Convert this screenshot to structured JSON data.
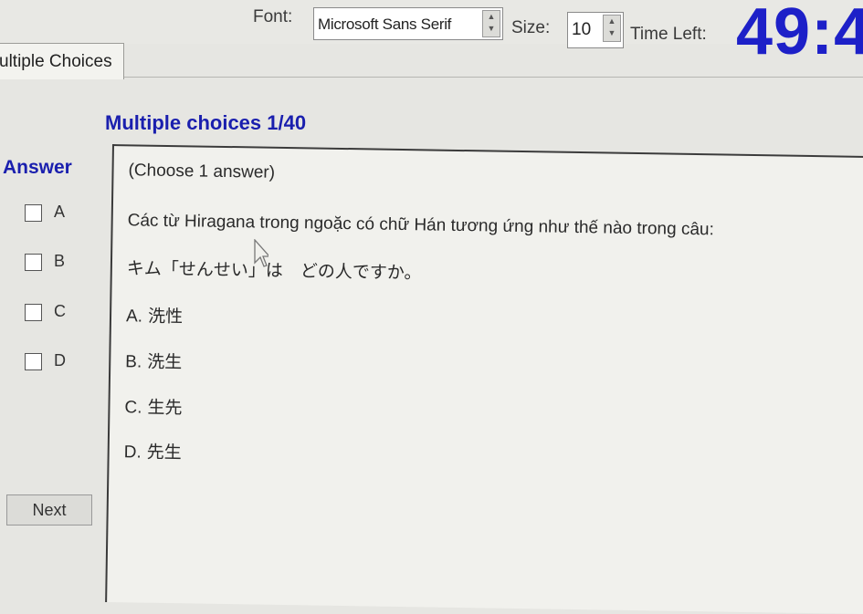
{
  "toolbar": {
    "font_label": "Font:",
    "font_value": "Microsoft Sans Serif",
    "size_label": "Size:",
    "size_value": "10",
    "time_left_label": "Time Left:",
    "time_left_value": "49:4"
  },
  "tab": {
    "label": "ultiple Choices"
  },
  "panel": {
    "title": "Multiple choices 1/40"
  },
  "answer": {
    "heading": "Answer",
    "options": [
      "A",
      "B",
      "C",
      "D"
    ],
    "next_label": "Next"
  },
  "question": {
    "hint": "(Choose 1 answer)",
    "text": "Các từ Hiragana trong ngoặc có chữ Hán tương ứng như thế nào trong câu:",
    "sentence": "キム「せんせい」は　どの人ですか。",
    "choices": [
      {
        "letter": "A.",
        "text": "洗性"
      },
      {
        "letter": "B.",
        "text": "洗生"
      },
      {
        "letter": "C.",
        "text": "生先"
      },
      {
        "letter": "D.",
        "text": "先生"
      }
    ]
  },
  "colors": {
    "accent": "#1a1fae",
    "timer": "#1d20c8"
  }
}
